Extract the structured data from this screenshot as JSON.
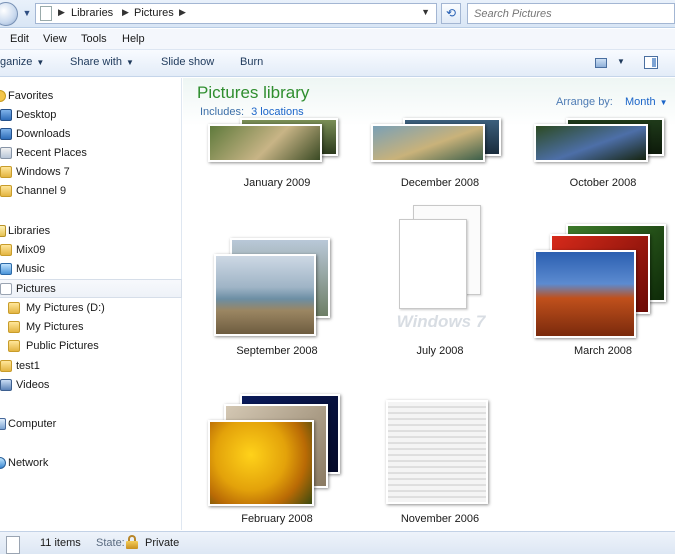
{
  "address_bar": {
    "breadcrumbs": [
      "Libraries",
      "Pictures"
    ],
    "search_placeholder": "Search Pictures"
  },
  "menu": [
    "Edit",
    "View",
    "Tools",
    "Help"
  ],
  "toolbar": {
    "organize_label": "ganize",
    "share_label": "Share with",
    "slideshow_label": "Slide show",
    "burn_label": "Burn"
  },
  "sidebar": {
    "favorites_header": "Favorites",
    "favorites": [
      "Desktop",
      "Downloads",
      "Recent Places",
      "Windows 7",
      "Channel 9"
    ],
    "libraries_header": "Libraries",
    "libraries": [
      "Mix09",
      "Music",
      "Pictures",
      "My Pictures (D:)",
      "My Pictures",
      "Public Pictures",
      "test1",
      "Videos"
    ],
    "computer_label": "Computer",
    "network_label": "Network"
  },
  "library": {
    "title": "Pictures library",
    "includes_label": "Includes:",
    "includes_link": "3 locations",
    "arrange_label": "Arrange by:",
    "arrange_value": "Month"
  },
  "tiles": [
    {
      "label": "January 2009"
    },
    {
      "label": "December 2008"
    },
    {
      "label": "October 2008"
    },
    {
      "label": "September 2008"
    },
    {
      "label": "July 2008",
      "watermark": "Windows 7"
    },
    {
      "label": "March 2008"
    },
    {
      "label": "February 2008"
    },
    {
      "label": "November 2006"
    }
  ],
  "status": {
    "count": "11 items",
    "state_label": "State:",
    "state_value": "Private"
  },
  "colors": {
    "library_title": "#2f8e2f",
    "link": "#1b65c9",
    "selected_row": "#eef2f8"
  }
}
